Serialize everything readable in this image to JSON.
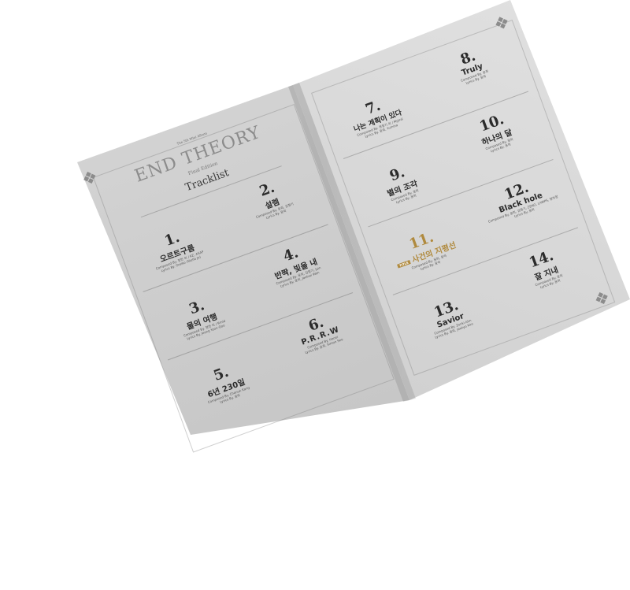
{
  "header": {
    "album_title": "END THEORY",
    "edition": "Final Edition",
    "section": "Tracklist",
    "tiny_caption": "The 5th Mini Album"
  },
  "tracks": [
    {
      "number": "1.",
      "title": "오르트구름",
      "credit1": "Composed By. 정한 외 / KZ, ASAP",
      "credit2": "Lyrics By. Oreiko (Stella Jo)"
    },
    {
      "number": "2.",
      "title": "설렘",
      "credit1": "Composed By. 윤희, 김형기",
      "credit2": "Lyrics By. 윤희"
    },
    {
      "number": "3.",
      "title": "물의 여행",
      "credit1": "Composed By. 정한 외 / Rmid",
      "credit2": "Lyrics By. Jeong Yoon-Goo"
    },
    {
      "number": "4.",
      "title": "반짝, 빛을 내",
      "credit1": "Composed By. 윤희, 김형기, Jain",
      "credit2": "Lyrics By. 윤희, Jaehwi Won"
    },
    {
      "number": "5.",
      "title": "6년 230일",
      "credit1": "Composed By. Chanuk Kang",
      "credit2": "Lyrics By. 윤희"
    },
    {
      "number": "6.",
      "title": "P.R.R.W",
      "credit1": "Composed By. Hanei",
      "credit2": "Lyrics By. 윤희, Simon Seo"
    },
    {
      "number": "7.",
      "title": "나는 계획이 있다",
      "credit1": "Composed By. 정형기 외 / Mgiral",
      "credit2": "Lyrics By. 윤희, Yumina"
    },
    {
      "number": "8.",
      "title": "Truly",
      "credit1": "Composed By. 윤희",
      "credit2": "Lyrics By. 윤희"
    },
    {
      "number": "9.",
      "title": "별의 조각",
      "credit1": "Composed By. 윤희",
      "credit2": "Lyrics By. 윤희"
    },
    {
      "number": "10.",
      "title": "하나의 달",
      "credit1": "Composed By. 윤희",
      "credit2": "Lyrics By. 윤희"
    },
    {
      "number": "11.",
      "title": "사건의 지평선",
      "badge": "TITLE",
      "credit1": "Composed By. 윤희, 윤하",
      "credit2": "Lyrics By. 윤하"
    },
    {
      "number": "12.",
      "title": "Black hole",
      "credit1": "Composed By. 윤희, 김형기, ZENO, LAMPS, 정하정",
      "credit2": "Lyrics By. 윤희"
    },
    {
      "number": "13.",
      "title": "Savior",
      "credit1": "Composed By. Zenki Ahn",
      "credit2": "Lyrics By. 윤희, Jaekyo Kim"
    },
    {
      "number": "14.",
      "title": "잘 지내",
      "credit1": "Composed By. 윤희",
      "credit2": "Lyrics By. 윤희"
    }
  ],
  "colors": {
    "paper": "#d6d6d6",
    "ink": "#2b2b2b",
    "title_gold": "#b08a3e",
    "background": "#ffffff"
  }
}
